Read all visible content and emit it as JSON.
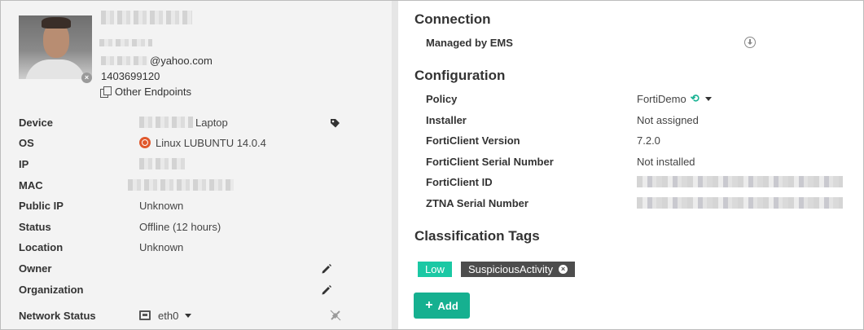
{
  "profile": {
    "email_suffix": "@yahoo.com",
    "phone": "1403699120",
    "other_endpoints_label": "Other Endpoints"
  },
  "device_details": [
    {
      "label": "Device",
      "value": "Laptop"
    },
    {
      "label": "OS",
      "value": "Linux LUBUNTU 14.0.4"
    },
    {
      "label": "IP",
      "value": ""
    },
    {
      "label": "MAC",
      "value": ""
    },
    {
      "label": "Public IP",
      "value": "Unknown"
    },
    {
      "label": "Status",
      "value": "Offline (12 hours)"
    },
    {
      "label": "Location",
      "value": "Unknown"
    },
    {
      "label": "Owner",
      "value": ""
    },
    {
      "label": "Organization",
      "value": ""
    },
    {
      "label": "Network Status",
      "value": "eth0"
    }
  ],
  "connection": {
    "title": "Connection",
    "managed_label": "Managed by EMS"
  },
  "configuration": {
    "title": "Configuration",
    "rows": [
      {
        "label": "Policy",
        "value": "FortiDemo"
      },
      {
        "label": "Installer",
        "value": "Not assigned"
      },
      {
        "label": "FortiClient Version",
        "value": "7.2.0"
      },
      {
        "label": "FortiClient Serial Number",
        "value": "Not installed"
      },
      {
        "label": "FortiClient ID",
        "value": ""
      },
      {
        "label": "ZTNA Serial Number",
        "value": ""
      }
    ]
  },
  "classification": {
    "title": "Classification Tags",
    "tags": [
      "Low",
      "SuspiciousActivity"
    ],
    "add_label": "Add"
  },
  "colors": {
    "accent": "#16b090",
    "tag_low": "#1bc8a4",
    "tag_dark": "#4d4d4d",
    "ubuntu": "#e0582c"
  },
  "icons": [
    "copy-icon",
    "tag-icon",
    "pencil-icon",
    "ubuntu-icon",
    "ethernet-icon",
    "disconnect-icon",
    "download-circle-icon",
    "sync-icon",
    "close-icon",
    "plus-icon"
  ]
}
